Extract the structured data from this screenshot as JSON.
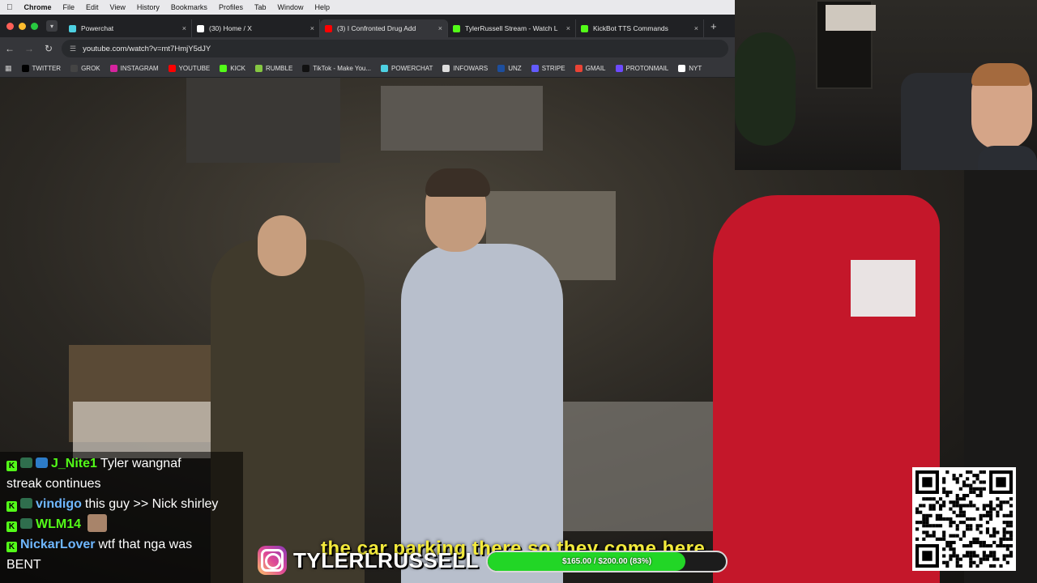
{
  "menubar": {
    "app_name": "Chrome",
    "items": [
      "File",
      "Edit",
      "View",
      "History",
      "Bookmarks",
      "Profiles",
      "Tab",
      "Window",
      "Help"
    ]
  },
  "tabs": [
    {
      "title": "Powerchat",
      "icon": "powerchat-icon",
      "color": "#4dd0e1",
      "active": false
    },
    {
      "title": "(30) Home / X",
      "icon": "x-icon",
      "color": "#ffffff",
      "active": false
    },
    {
      "title": "(3) I Confronted Drug Add",
      "icon": "youtube-icon",
      "color": "#ff0000",
      "active": true
    },
    {
      "title": "TylerRussell Stream - Watch L",
      "icon": "kick-icon",
      "color": "#53fc18",
      "active": false
    },
    {
      "title": "KickBot TTS Commands",
      "icon": "kick-icon",
      "color": "#53fc18",
      "active": false
    }
  ],
  "address_bar": {
    "url": "youtube.com/watch?v=mt7HmjY5dJY"
  },
  "bookmarks": [
    {
      "label": "TWITTER",
      "icon": "x-icon",
      "color": "#000000"
    },
    {
      "label": "GROK",
      "icon": "grok-icon",
      "color": "#444444"
    },
    {
      "label": "INSTAGRAM",
      "icon": "instagram-icon",
      "color": "#d6249f"
    },
    {
      "label": "YOUTUBE",
      "icon": "youtube-icon",
      "color": "#ff0000"
    },
    {
      "label": "KICK",
      "icon": "kick-icon",
      "color": "#53fc18"
    },
    {
      "label": "RUMBLE",
      "icon": "rumble-icon",
      "color": "#85c742"
    },
    {
      "label": "TikTok - Make You...",
      "icon": "tiktok-icon",
      "color": "#111111"
    },
    {
      "label": "POWERCHAT",
      "icon": "powerchat-icon",
      "color": "#4dd0e1"
    },
    {
      "label": "INFOWARS",
      "icon": "infowars-icon",
      "color": "#dddddd"
    },
    {
      "label": "UNZ",
      "icon": "unz-icon",
      "color": "#1d4e9e"
    },
    {
      "label": "STRIPE",
      "icon": "stripe-icon",
      "color": "#635bff"
    },
    {
      "label": "GMAIL",
      "icon": "gmail-icon",
      "color": "#ea4335"
    },
    {
      "label": "PROTONMAIL",
      "icon": "protonmail-icon",
      "color": "#6d4aff"
    },
    {
      "label": "NYT",
      "icon": "nyt-icon",
      "color": "#ffffff"
    }
  ],
  "chat": {
    "messages": [
      {
        "user": "J_Nite1",
        "user_color": "#53fc18",
        "text": "Tyler wangnaf"
      },
      {
        "user": "",
        "user_color": "#ffffff",
        "text": "streak continues"
      },
      {
        "user": "vindigo",
        "user_color": "#6fb7ff",
        "text": "this guy >> Nick shirley"
      },
      {
        "user": "WLM14",
        "user_color": "#53fc18",
        "text": ""
      },
      {
        "user": "NickarLover",
        "user_color": "#6fb7ff",
        "text": "wtf that nga was"
      },
      {
        "user": "",
        "user_color": "#ffffff",
        "text": "BENT"
      }
    ]
  },
  "caption": {
    "text": "the car parking there so they come here"
  },
  "instagram": {
    "handle": "TYLERLRUSSELL"
  },
  "goal": {
    "text": "$165.00 / $200.00 (83%)",
    "current": 165,
    "target": 200,
    "fraction": 0.83,
    "fill_color": "#22d626"
  }
}
